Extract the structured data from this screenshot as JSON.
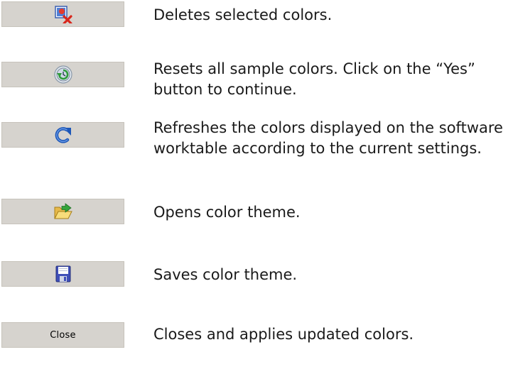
{
  "rows": [
    {
      "icon": "delete-colors-icon",
      "description": "Deletes selected colors."
    },
    {
      "icon": "reset-icon",
      "description": "Resets all sample colors. Click on the “Yes” button to continue."
    },
    {
      "icon": "refresh-icon",
      "description": "Refreshes the colors displayed on the software worktable according to the current settings."
    },
    {
      "icon": "open-folder-icon",
      "description": "Opens color theme."
    },
    {
      "icon": "save-disk-icon",
      "description": "Saves color theme."
    },
    {
      "button_label": "Close",
      "description": "Closes and applies updated colors."
    }
  ]
}
